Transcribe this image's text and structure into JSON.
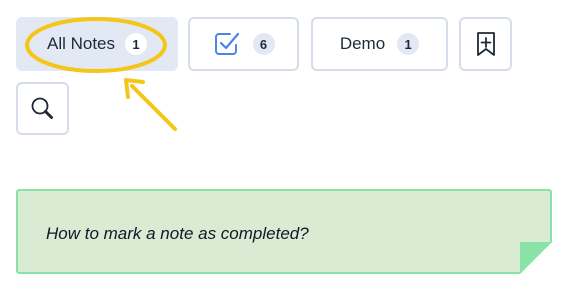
{
  "toolbar": {
    "all_notes": {
      "label": "All Notes",
      "count": "1"
    },
    "completed": {
      "icon": "checkbox-check-icon",
      "count": "6"
    },
    "demo": {
      "label": "Demo",
      "count": "1"
    },
    "add_note": {
      "icon": "bookmark-plus-icon"
    },
    "search": {
      "icon": "search-icon"
    }
  },
  "note": {
    "text": "How to mark a note as completed?"
  },
  "colors": {
    "active_button_bg": "#e2e8f4",
    "button_border": "#d5dde8",
    "note_bg": "#d9ebd2",
    "note_border": "#89e3a6",
    "highlight": "#f5c518",
    "checkbox_icon": "#4a86e8"
  }
}
